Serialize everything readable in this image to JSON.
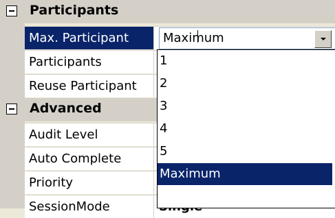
{
  "categories": {
    "participants": {
      "label": "Participants",
      "rows": [
        {
          "name": "Max. Participant",
          "value": ""
        },
        {
          "name": "Participants",
          "value": ""
        },
        {
          "name": "Reuse Participant",
          "value": ""
        }
      ]
    },
    "advanced": {
      "label": "Advanced",
      "rows": [
        {
          "name": "Audit Level",
          "value": ""
        },
        {
          "name": "Auto Complete",
          "value": ""
        },
        {
          "name": "Priority",
          "value": ""
        },
        {
          "name": "SessionMode",
          "value": "Single"
        }
      ]
    }
  },
  "editor": {
    "value": "Maximum",
    "dropdown_options": [
      "1",
      "2",
      "3",
      "4",
      "5",
      "Maximum"
    ],
    "selected_option": "Maximum"
  },
  "colors": {
    "selection": "#0a246a",
    "category_background": "#d4d0c8",
    "grid_line": "#d4d0c8"
  },
  "icons": {
    "collapse": "minus-box-icon",
    "dropdown": "chevron-down-icon"
  }
}
